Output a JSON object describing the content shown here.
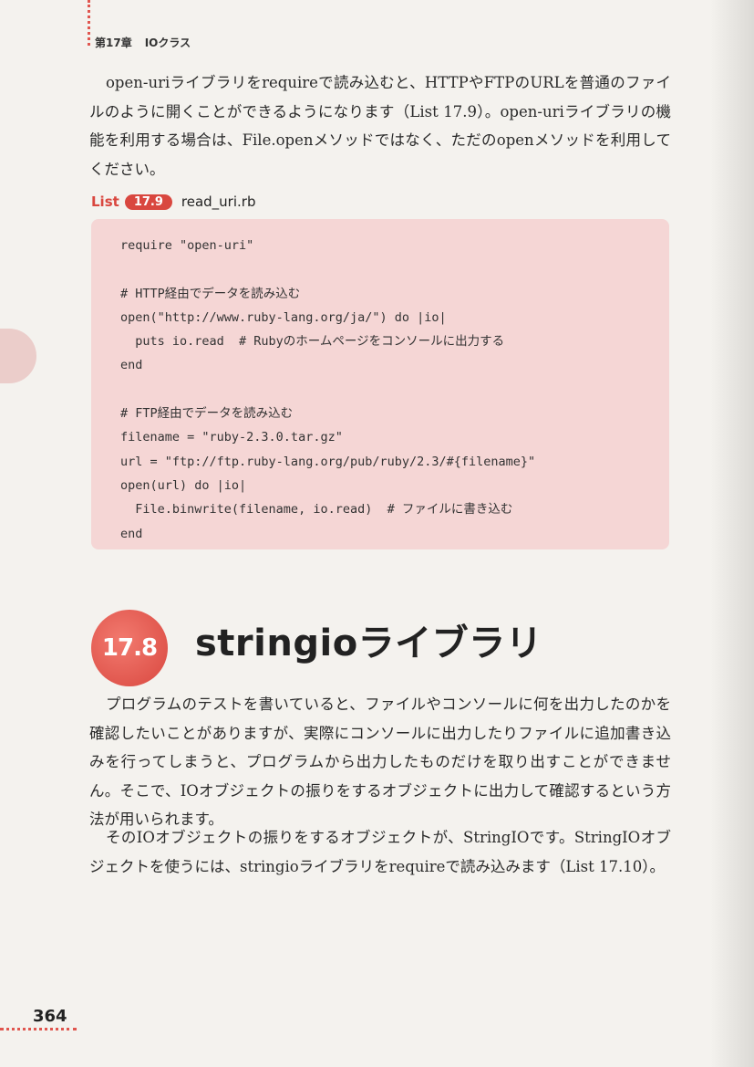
{
  "running_head": {
    "chapter": "第17章",
    "title": "IOクラス"
  },
  "intro_paragraph": "open-uriライブラリをrequireで読み込むと、HTTPやFTPのURLを普通のファイルのように開くことができるようになります（List 17.9）。open-uriライブラリの機能を利用する場合は、File.openメソッドではなく、ただのopenメソッドを利用してください。",
  "listing": {
    "label": "List",
    "number": "17.9",
    "filename": "read_uri.rb",
    "code": "require \"open-uri\"\n\n# HTTP経由でデータを読み込む\nopen(\"http://www.ruby-lang.org/ja/\") do |io|\n  puts io.read  # Rubyのホームページをコンソールに出力する\nend\n\n# FTP経由でデータを読み込む\nfilename = \"ruby-2.3.0.tar.gz\"\nurl = \"ftp://ftp.ruby-lang.org/pub/ruby/2.3/#{filename}\"\nopen(url) do |io|\n  File.binwrite(filename, io.read)  # ファイルに書き込む\nend"
  },
  "section": {
    "number": "17.8",
    "title": "stringioライブラリ"
  },
  "body_paragraph_1": "プログラムのテストを書いていると、ファイルやコンソールに何を出力したのかを確認したいことがありますが、実際にコンソールに出力したりファイルに追加書き込みを行ってしまうと、プログラムから出力したものだけを取り出すことができません。そこで、IOオブジェクトの振りをするオブジェクトに出力して確認するという方法が用いられます。",
  "body_paragraph_2": "そのIOオブジェクトの振りをするオブジェクトが、StringIOです。StringIOオブジェクトを使うには、stringioライブラリをrequireで読み込みます（List 17.10）。",
  "page_number": "364"
}
